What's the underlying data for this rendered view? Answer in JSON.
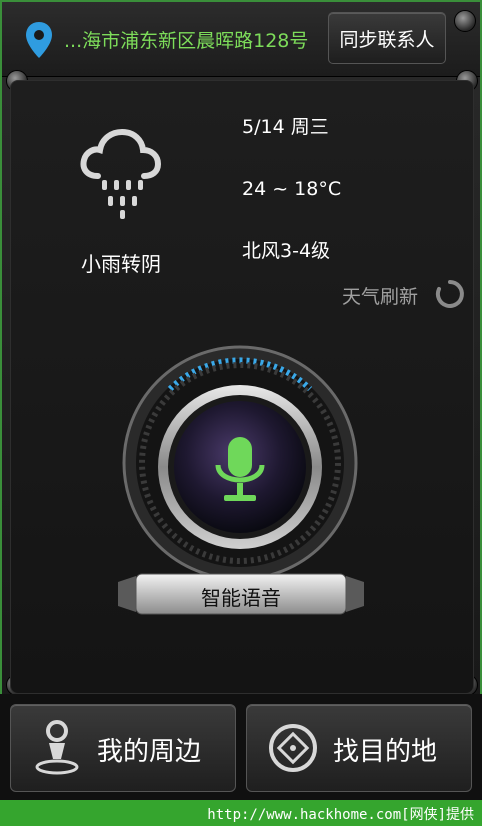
{
  "header": {
    "address": "...海市浦东新区晨晖路128号",
    "sync_button": "同步联系人"
  },
  "weather": {
    "condition": "小雨转阴",
    "date": "5/14 周三",
    "temperature": "24 ~ 18°C",
    "wind": "北风3-4级",
    "refresh_label": "天气刷新",
    "icon": "rain-cloud-icon"
  },
  "voice": {
    "label": "智能语音",
    "icon": "microphone-icon"
  },
  "bottom": {
    "nearby_label": "我的周边",
    "destination_label": "找目的地"
  },
  "footer": {
    "credit": "http://www.hackhome.com[网侠]提供"
  },
  "colors": {
    "accent_green": "#7ddc5a",
    "footer_green": "#35a52e",
    "mic_green": "#6fd85a",
    "ring_blue": "#3aa8e8"
  }
}
